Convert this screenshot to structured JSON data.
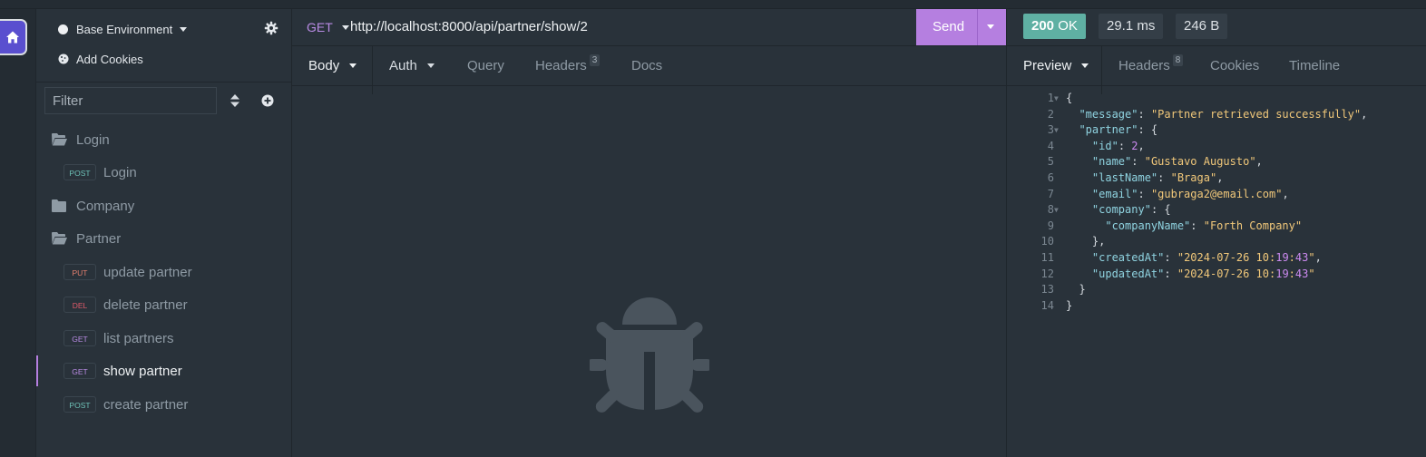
{
  "sidebar": {
    "environment": "Base Environment",
    "cookies": "Add Cookies",
    "filter_placeholder": "Filter",
    "items": [
      {
        "type": "folder-open",
        "label": "Login"
      },
      {
        "type": "request",
        "method": "POST",
        "label": "Login"
      },
      {
        "type": "folder-closed",
        "label": "Company"
      },
      {
        "type": "folder-open",
        "label": "Partner"
      },
      {
        "type": "request",
        "method": "PUT",
        "label": "update partner"
      },
      {
        "type": "request",
        "method": "DEL",
        "label": "delete partner"
      },
      {
        "type": "request",
        "method": "GET",
        "label": "list partners"
      },
      {
        "type": "request",
        "method": "GET",
        "label": "show partner",
        "active": true
      },
      {
        "type": "request",
        "method": "POST",
        "label": "create partner"
      }
    ]
  },
  "request": {
    "method": "GET",
    "url": "http://localhost:8000/api/partner/show/2",
    "send_label": "Send",
    "tabs": {
      "body": "Body",
      "auth": "Auth",
      "query": "Query",
      "headers": "Headers",
      "headers_count": "3",
      "docs": "Docs"
    }
  },
  "response": {
    "status_code": "200",
    "status_text": "OK",
    "time": "29.1 ms",
    "size": "246 B",
    "tabs": {
      "preview": "Preview",
      "headers": "Headers",
      "headers_count": "8",
      "cookies": "Cookies",
      "timeline": "Timeline"
    },
    "json_lines": [
      "{",
      "  \"message\": \"Partner retrieved successfully\",",
      "  \"partner\": {",
      "    \"id\": 2,",
      "    \"name\": \"Gustavo Augusto\",",
      "    \"lastName\": \"Braga\",",
      "    \"email\": \"gubraga2@email.com\",",
      "    \"company\": {",
      "      \"companyName\": \"Forth Company\"",
      "    },",
      "    \"createdAt\": \"2024-07-26 10:19:43\",",
      "    \"updatedAt\": \"2024-07-26 10:19:43\"",
      "  }",
      "}"
    ]
  },
  "icons": {
    "home": "home-icon",
    "settings": "gear-icon",
    "cookies": "cookie-icon",
    "sort": "sort-icon",
    "add": "plus-circle-icon",
    "empty_state": "bug-icon"
  },
  "colors": {
    "accent": "#b57fe0",
    "status_ok": "#5fb0a3",
    "background": "#29323a"
  }
}
